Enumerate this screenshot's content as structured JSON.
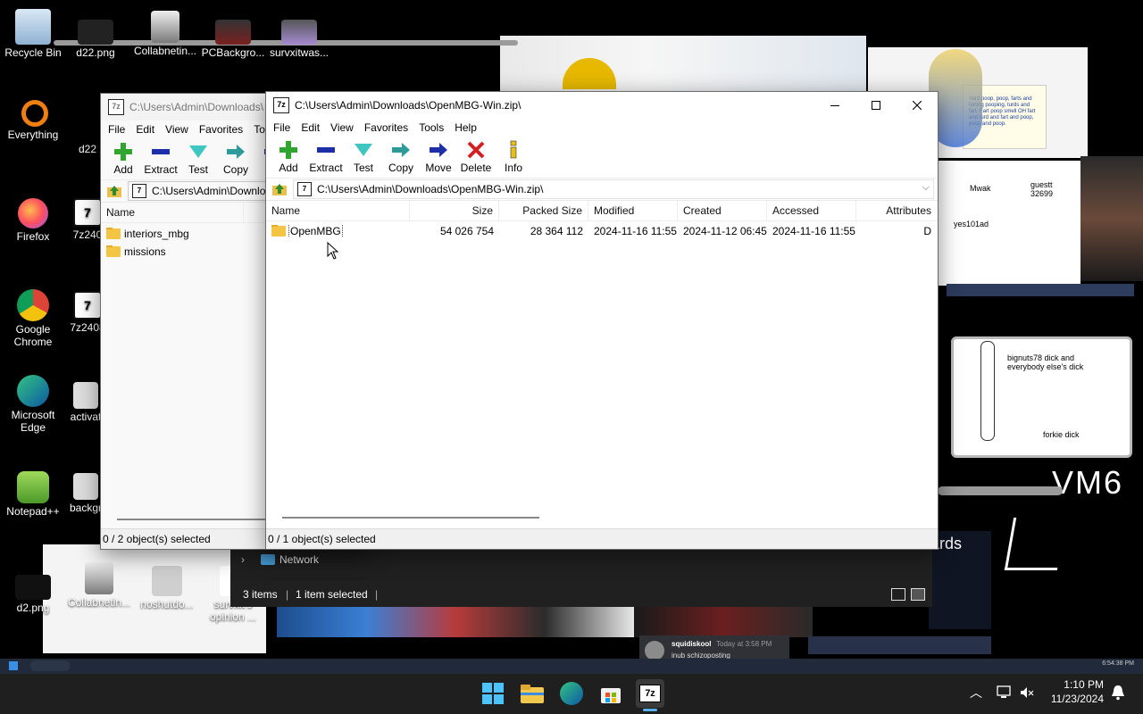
{
  "desktop": {
    "icons": [
      {
        "label": "Recycle Bin"
      },
      {
        "label": "d22.png"
      },
      {
        "label": "Collabnetin..."
      },
      {
        "label": "PCBackgro..."
      },
      {
        "label": "survxitwas..."
      },
      {
        "label": "Everything"
      },
      {
        "label": "d22"
      },
      {
        "label": "Firefox"
      },
      {
        "label": "7z240"
      },
      {
        "label": "Google Chrome"
      },
      {
        "label": "7z2408"
      },
      {
        "label": "Microsoft Edge"
      },
      {
        "label": "activat"
      },
      {
        "label": "Notepad++"
      },
      {
        "label": "backgr"
      },
      {
        "label": "d2.png"
      },
      {
        "label": "Collabnetin..."
      },
      {
        "label": "noshutdo..."
      },
      {
        "label": "survxit's opinion ..."
      }
    ],
    "overlay_text": {
      "vm_label": "VM6",
      "drawing_caption_1": "bignuts78 dick and everybody else's dick",
      "drawing_caption_2": "forkie dick",
      "note_text": "Yard poop, poop, farts and farting pooping, turds and fart. Fart poop smell OH fart and turd and fart and poop, poop and poop.",
      "sketch_label_1": "guestt 32699",
      "sketch_label_2": "yes101ad",
      "sketch_label_3": "Mwak",
      "chat_name": "squidiskool",
      "chat_time": "Today at 3:58 PM",
      "chat_text": "inub schizoposting",
      "ards_text": "ards"
    }
  },
  "back_window": {
    "title": "C:\\Users\\Admin\\Downloads\\",
    "menu": [
      "File",
      "Edit",
      "View",
      "Favorites",
      "To"
    ],
    "toolbar": [
      "Add",
      "Extract",
      "Test",
      "Copy",
      "M"
    ],
    "address": "C:\\Users\\Admin\\Downlo",
    "column_name": "Name",
    "items": [
      "interiors_mbg",
      "missions"
    ],
    "status": "0 / 2 object(s) selected"
  },
  "front_window": {
    "title": "C:\\Users\\Admin\\Downloads\\OpenMBG-Win.zip\\",
    "menu": [
      "File",
      "Edit",
      "View",
      "Favorites",
      "Tools",
      "Help"
    ],
    "toolbar": [
      "Add",
      "Extract",
      "Test",
      "Copy",
      "Move",
      "Delete",
      "Info"
    ],
    "address": "C:\\Users\\Admin\\Downloads\\OpenMBG-Win.zip\\",
    "columns": [
      "Name",
      "Size",
      "Packed Size",
      "Modified",
      "Created",
      "Accessed",
      "Attributes"
    ],
    "rows": [
      {
        "name": "OpenMBG",
        "size": "54 026 754",
        "packed": "28 364 112",
        "modified": "2024-11-16 11:55",
        "created": "2024-11-12 06:45",
        "accessed": "2024-11-16 11:55",
        "attributes": "D"
      }
    ],
    "status": "0 / 1 object(s) selected"
  },
  "explorer": {
    "nav_item": "Network",
    "status_items": "3 items",
    "status_selected": "1 item selected"
  },
  "taskbar": {
    "time": "1:10 PM",
    "date": "11/23/2024",
    "mini_time": "6:54:38 PM"
  }
}
